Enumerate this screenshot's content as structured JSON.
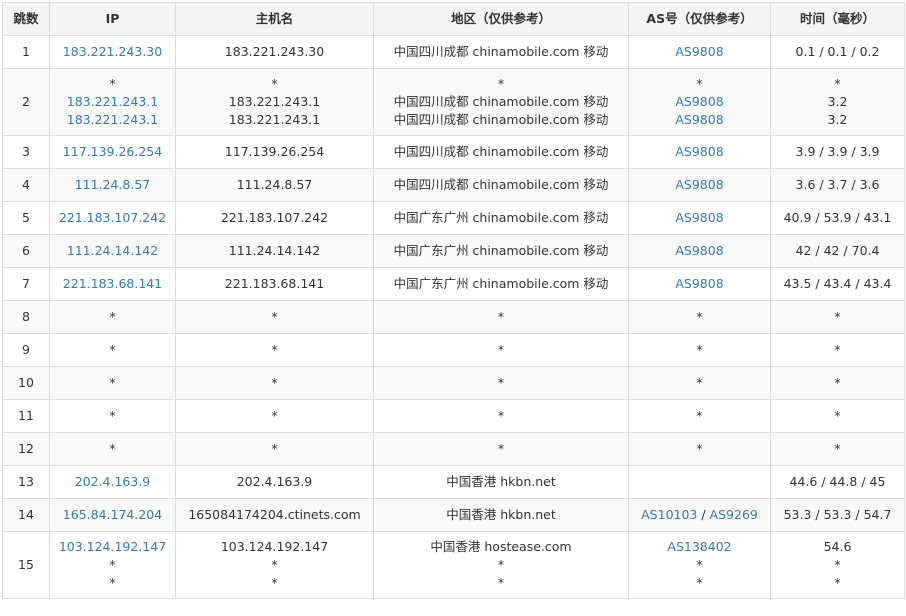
{
  "headers": [
    "跳数",
    "IP",
    "主机名",
    "地区（仅供参考）",
    "AS号（仅供参考）",
    "时间（毫秒）"
  ],
  "rows": [
    {
      "ttl": "1",
      "ip": [
        "183.221.243.30"
      ],
      "host": [
        "183.221.243.30"
      ],
      "region": [
        "中国四川成都 chinamobile.com 移动"
      ],
      "asn": [
        [
          "AS9808"
        ]
      ],
      "time": [
        "0.1 / 0.1 / 0.2"
      ]
    },
    {
      "ttl": "2",
      "ip": [
        "*",
        "183.221.243.1",
        "183.221.243.1"
      ],
      "host": [
        "*",
        "183.221.243.1",
        "183.221.243.1"
      ],
      "region": [
        "*",
        "中国四川成都 chinamobile.com 移动",
        "中国四川成都 chinamobile.com 移动"
      ],
      "asn": [
        [
          "*"
        ],
        [
          "AS9808"
        ],
        [
          "AS9808"
        ]
      ],
      "time": [
        "*",
        "3.2",
        "3.2"
      ]
    },
    {
      "ttl": "3",
      "ip": [
        "117.139.26.254"
      ],
      "host": [
        "117.139.26.254"
      ],
      "region": [
        "中国四川成都 chinamobile.com 移动"
      ],
      "asn": [
        [
          "AS9808"
        ]
      ],
      "time": [
        "3.9 / 3.9 / 3.9"
      ]
    },
    {
      "ttl": "4",
      "ip": [
        "111.24.8.57"
      ],
      "host": [
        "111.24.8.57"
      ],
      "region": [
        "中国四川成都 chinamobile.com 移动"
      ],
      "asn": [
        [
          "AS9808"
        ]
      ],
      "time": [
        "3.6 / 3.7 / 3.6"
      ]
    },
    {
      "ttl": "5",
      "ip": [
        "221.183.107.242"
      ],
      "host": [
        "221.183.107.242"
      ],
      "region": [
        "中国广东广州 chinamobile.com 移动"
      ],
      "asn": [
        [
          "AS9808"
        ]
      ],
      "time": [
        "40.9 / 53.9 / 43.1"
      ]
    },
    {
      "ttl": "6",
      "ip": [
        "111.24.14.142"
      ],
      "host": [
        "111.24.14.142"
      ],
      "region": [
        "中国广东广州 chinamobile.com 移动"
      ],
      "asn": [
        [
          "AS9808"
        ]
      ],
      "time": [
        "42 / 42 / 70.4"
      ]
    },
    {
      "ttl": "7",
      "ip": [
        "221.183.68.141"
      ],
      "host": [
        "221.183.68.141"
      ],
      "region": [
        "中国广东广州 chinamobile.com 移动"
      ],
      "asn": [
        [
          "AS9808"
        ]
      ],
      "time": [
        "43.5 / 43.4 / 43.4"
      ]
    },
    {
      "ttl": "8",
      "ip": [
        "*"
      ],
      "host": [
        "*"
      ],
      "region": [
        "*"
      ],
      "asn": [
        [
          "*"
        ]
      ],
      "time": [
        "*"
      ]
    },
    {
      "ttl": "9",
      "ip": [
        "*"
      ],
      "host": [
        "*"
      ],
      "region": [
        "*"
      ],
      "asn": [
        [
          "*"
        ]
      ],
      "time": [
        "*"
      ]
    },
    {
      "ttl": "10",
      "ip": [
        "*"
      ],
      "host": [
        "*"
      ],
      "region": [
        "*"
      ],
      "asn": [
        [
          "*"
        ]
      ],
      "time": [
        "*"
      ]
    },
    {
      "ttl": "11",
      "ip": [
        "*"
      ],
      "host": [
        "*"
      ],
      "region": [
        "*"
      ],
      "asn": [
        [
          "*"
        ]
      ],
      "time": [
        "*"
      ]
    },
    {
      "ttl": "12",
      "ip": [
        "*"
      ],
      "host": [
        "*"
      ],
      "region": [
        "*"
      ],
      "asn": [
        [
          "*"
        ]
      ],
      "time": [
        "*"
      ]
    },
    {
      "ttl": "13",
      "ip": [
        "202.4.163.9"
      ],
      "host": [
        "202.4.163.9"
      ],
      "region": [
        "中国香港 hkbn.net"
      ],
      "asn": [
        []
      ],
      "time": [
        "44.6 / 44.8 / 45"
      ]
    },
    {
      "ttl": "14",
      "ip": [
        "165.84.174.204"
      ],
      "host": [
        "165084174204.ctinets.com"
      ],
      "region": [
        "中国香港 hkbn.net"
      ],
      "asn": [
        [
          "AS10103",
          "AS9269"
        ]
      ],
      "time": [
        "53.3 / 53.3 / 54.7"
      ]
    },
    {
      "ttl": "15",
      "ip": [
        "103.124.192.147",
        "*",
        "*"
      ],
      "host": [
        "103.124.192.147",
        "*",
        "*"
      ],
      "region": [
        "中国香港 hostease.com",
        "*",
        "*"
      ],
      "asn": [
        [
          "AS138402"
        ],
        [
          "*"
        ],
        [
          "*"
        ]
      ],
      "time": [
        "54.6",
        "*",
        "*"
      ]
    }
  ],
  "asn_separator": " / ",
  "colors": {
    "link": "#337ab7",
    "text": "#333333",
    "border": "#dddddd",
    "header_bg": "#f5f5f5",
    "stripe_bg": "#f9f9f9"
  }
}
